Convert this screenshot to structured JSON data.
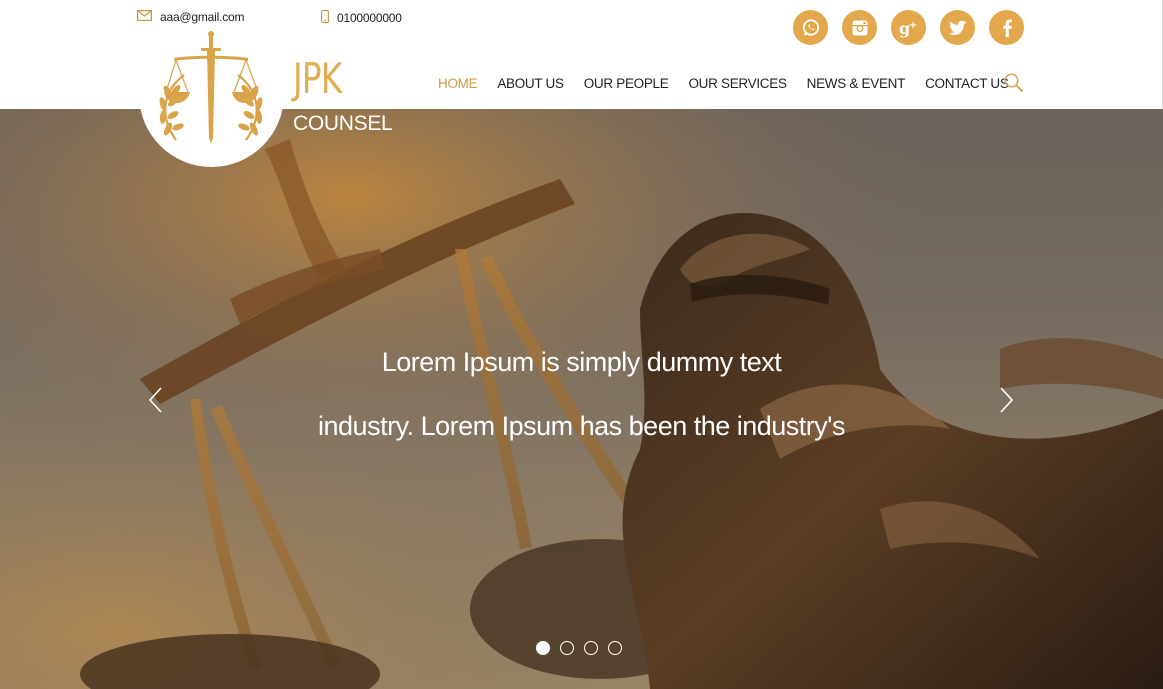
{
  "header": {
    "email": "aaa@gmail.com",
    "phone": "0100000000",
    "email_icon": "mail-icon",
    "phone_icon": "phone-icon"
  },
  "socials": [
    {
      "name": "whatsapp",
      "icon": "whatsapp-icon"
    },
    {
      "name": "instagram",
      "icon": "instagram-icon"
    },
    {
      "name": "google-plus",
      "icon": "google-plus-icon"
    },
    {
      "name": "twitter",
      "icon": "twitter-icon"
    },
    {
      "name": "facebook",
      "icon": "facebook-icon"
    }
  ],
  "logo": {
    "name": "JPK",
    "sub": "COUNSEL",
    "icon": "scales-of-justice-icon"
  },
  "nav": {
    "items": [
      {
        "label": "HOME",
        "active": true
      },
      {
        "label": "ABOUT US"
      },
      {
        "label": "OUR PEOPLE"
      },
      {
        "label": "OUR SERVICES"
      },
      {
        "label": "NEWS & EVENT"
      },
      {
        "label": "CONTACT US"
      }
    ],
    "search_icon": "search-icon"
  },
  "hero": {
    "line1": "Lorem Ipsum is simply dummy text",
    "line2": "industry. Lorem Ipsum has been the industry's",
    "prev_icon": "chevron-left-icon",
    "next_icon": "chevron-right-icon",
    "slide_count": 4,
    "active_slide": 1
  },
  "colors": {
    "accent": "#e2a84b",
    "nav_active": "#d09a45",
    "text": "#222222"
  }
}
